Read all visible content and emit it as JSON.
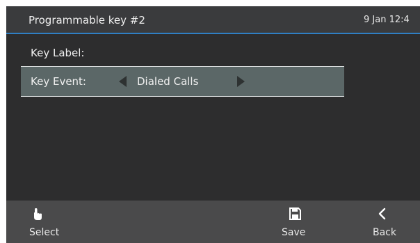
{
  "header": {
    "title": "Programmable key #2",
    "datetime": "9 Jan 12:4"
  },
  "form": {
    "key_label": "Key Label:",
    "key_event_label": "Key Event:",
    "key_event_value": "Dialed Calls"
  },
  "softkeys": {
    "select": {
      "label": "Select",
      "icon": "hand-pointer-icon"
    },
    "save": {
      "label": "Save",
      "icon": "floppy-disk-icon"
    },
    "back": {
      "label": "Back",
      "icon": "chevron-left-icon"
    }
  },
  "colors": {
    "accent": "#2f7fc4",
    "background": "#2d2d2e",
    "selected_row": "#5b6767",
    "softkey_bar": "#4a4a4b"
  }
}
